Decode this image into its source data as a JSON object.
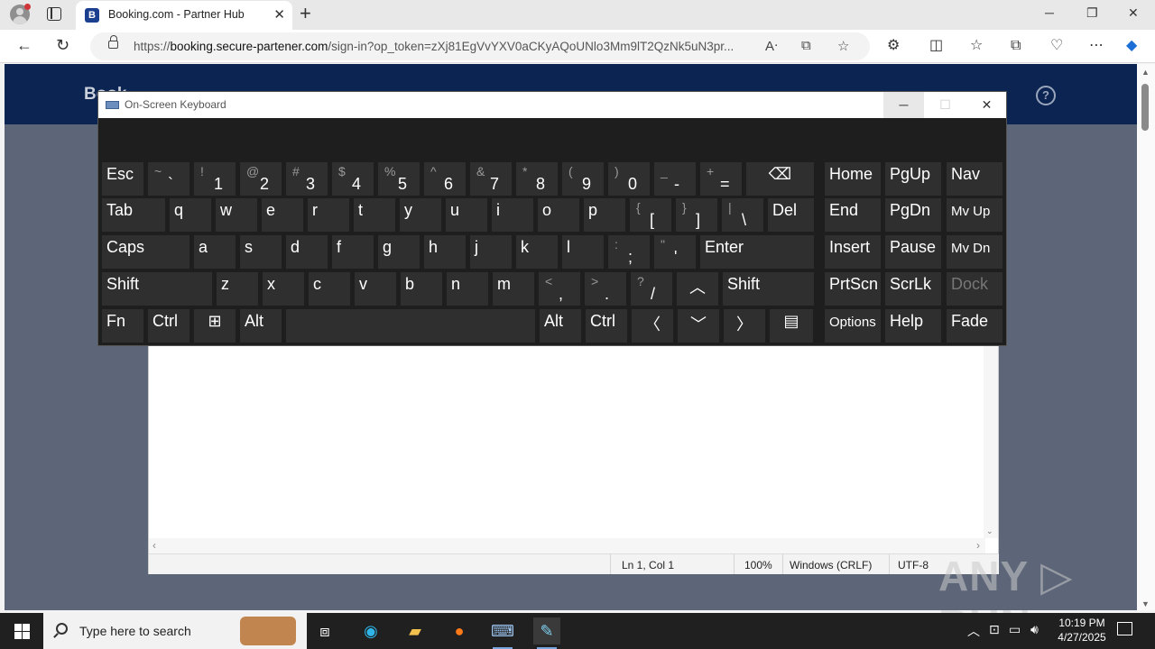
{
  "browser": {
    "tab_title": "Booking.com - Partner Hub",
    "tab_favicon": "B",
    "url_prefix": "https://",
    "url_host": "booking.secure-partener.com",
    "url_rest": "/sign-in?op_token=zXj81EgVvYXV0aCKyAQoUNlo3Mm9lT2QzNk5uN3pr..."
  },
  "page": {
    "brand": "Book",
    "help": "?"
  },
  "notepad": {
    "status_position": "Ln 1, Col 1",
    "status_zoom": "100%",
    "status_eol": "Windows (CRLF)",
    "status_encoding": "UTF-8"
  },
  "osk": {
    "title": "On-Screen Keyboard",
    "rows": [
      [
        {
          "id": "esc",
          "label": "Esc"
        },
        {
          "id": "backtick",
          "top": "~",
          "bot": "`"
        },
        {
          "id": "1",
          "top": "!",
          "bot": "1"
        },
        {
          "id": "2",
          "top": "@",
          "bot": "2"
        },
        {
          "id": "3",
          "top": "#",
          "bot": "3"
        },
        {
          "id": "4",
          "top": "$",
          "bot": "4"
        },
        {
          "id": "5",
          "top": "%",
          "bot": "5"
        },
        {
          "id": "6",
          "top": "^",
          "bot": "6"
        },
        {
          "id": "7",
          "top": "&",
          "bot": "7"
        },
        {
          "id": "8",
          "top": "*",
          "bot": "8"
        },
        {
          "id": "9",
          "top": "(",
          "bot": "9"
        },
        {
          "id": "0",
          "top": ")",
          "bot": "0"
        },
        {
          "id": "minus",
          "top": "_",
          "bot": "-"
        },
        {
          "id": "equals",
          "top": "+",
          "bot": "="
        },
        {
          "id": "backspace",
          "label": "⌫"
        },
        {
          "id": "home",
          "label": "Home"
        },
        {
          "id": "pgup",
          "label": "PgUp"
        },
        {
          "id": "nav",
          "label": "Nav"
        }
      ],
      [
        {
          "id": "tab",
          "label": "Tab"
        },
        {
          "id": "q",
          "label": "q"
        },
        {
          "id": "w",
          "label": "w"
        },
        {
          "id": "e",
          "label": "e"
        },
        {
          "id": "r",
          "label": "r"
        },
        {
          "id": "t",
          "label": "t"
        },
        {
          "id": "y",
          "label": "y"
        },
        {
          "id": "u",
          "label": "u"
        },
        {
          "id": "i",
          "label": "i"
        },
        {
          "id": "o",
          "label": "o"
        },
        {
          "id": "p",
          "label": "p"
        },
        {
          "id": "lbracket",
          "top": "{",
          "bot": "["
        },
        {
          "id": "rbracket",
          "top": "}",
          "bot": "]"
        },
        {
          "id": "backslash",
          "top": "|",
          "bot": "\\"
        },
        {
          "id": "del",
          "label": "Del"
        },
        {
          "id": "end",
          "label": "End"
        },
        {
          "id": "pgdn",
          "label": "PgDn"
        },
        {
          "id": "mvup",
          "label": "Mv Up"
        }
      ],
      [
        {
          "id": "caps",
          "label": "Caps"
        },
        {
          "id": "a",
          "label": "a"
        },
        {
          "id": "s",
          "label": "s"
        },
        {
          "id": "d",
          "label": "d"
        },
        {
          "id": "f",
          "label": "f"
        },
        {
          "id": "g",
          "label": "g"
        },
        {
          "id": "h",
          "label": "h"
        },
        {
          "id": "j",
          "label": "j"
        },
        {
          "id": "k",
          "label": "k"
        },
        {
          "id": "l",
          "label": "l"
        },
        {
          "id": "semicolon",
          "top": ":",
          "bot": ";"
        },
        {
          "id": "quote",
          "top": "\"",
          "bot": "'"
        },
        {
          "id": "enter",
          "label": "Enter"
        },
        {
          "id": "insert",
          "label": "Insert"
        },
        {
          "id": "pause",
          "label": "Pause"
        },
        {
          "id": "mvdn",
          "label": "Mv Dn"
        }
      ],
      [
        {
          "id": "lshift",
          "label": "Shift"
        },
        {
          "id": "z",
          "label": "z"
        },
        {
          "id": "x",
          "label": "x"
        },
        {
          "id": "c",
          "label": "c"
        },
        {
          "id": "v",
          "label": "v"
        },
        {
          "id": "b",
          "label": "b"
        },
        {
          "id": "n",
          "label": "n"
        },
        {
          "id": "m",
          "label": "m"
        },
        {
          "id": "comma",
          "top": "<",
          "bot": ","
        },
        {
          "id": "period",
          "top": ">",
          "bot": "."
        },
        {
          "id": "slash",
          "top": "?",
          "bot": "/"
        },
        {
          "id": "uparrow",
          "label": "︿"
        },
        {
          "id": "rshift",
          "label": "Shift"
        },
        {
          "id": "prtscn",
          "label": "PrtScn"
        },
        {
          "id": "scrlk",
          "label": "ScrLk"
        },
        {
          "id": "dock",
          "label": "Dock"
        }
      ],
      [
        {
          "id": "fn",
          "label": "Fn"
        },
        {
          "id": "lctrl",
          "label": "Ctrl"
        },
        {
          "id": "win",
          "label": "⊞"
        },
        {
          "id": "lalt",
          "label": "Alt"
        },
        {
          "id": "space",
          "label": ""
        },
        {
          "id": "ralt",
          "label": "Alt"
        },
        {
          "id": "rctrl",
          "label": "Ctrl"
        },
        {
          "id": "leftarrow",
          "label": "〈"
        },
        {
          "id": "downarrow",
          "label": "﹀"
        },
        {
          "id": "rightarrow",
          "label": "〉"
        },
        {
          "id": "menu",
          "label": "▤"
        },
        {
          "id": "options",
          "label": "Options"
        },
        {
          "id": "help",
          "label": "Help"
        },
        {
          "id": "fade",
          "label": "Fade"
        }
      ]
    ]
  },
  "watermark": "ANY ▷ RUN",
  "taskbar": {
    "search_placeholder": "Type here to search",
    "time": "10:19 PM",
    "date": "4/27/2025"
  }
}
